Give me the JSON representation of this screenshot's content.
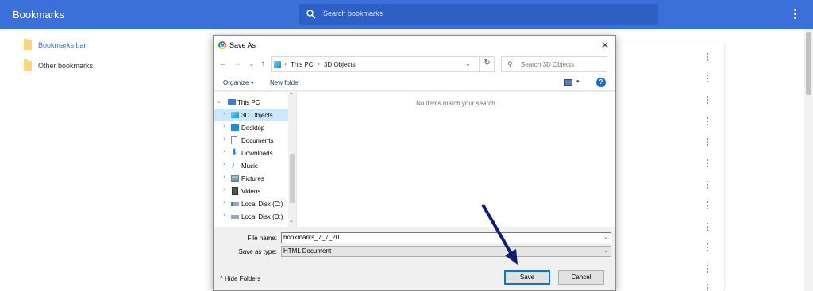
{
  "page": {
    "title": "Bookmarks",
    "search_placeholder": "Search bookmarks",
    "sidebar": [
      {
        "label": "Bookmarks bar",
        "active": true
      },
      {
        "label": "Other bookmarks",
        "active": false
      }
    ]
  },
  "dialog": {
    "title": "Save As",
    "breadcrumb": [
      "This PC",
      "3D Objects"
    ],
    "search_placeholder": "Search 3D Objects",
    "commands": {
      "organize": "Organize ▾",
      "new_folder": "New folder"
    },
    "tree": [
      {
        "label": "This PC",
        "icon": "pc-icon"
      },
      {
        "label": "3D Objects",
        "icon": "cube-icon"
      },
      {
        "label": "Desktop",
        "icon": "desktop-icon"
      },
      {
        "label": "Documents",
        "icon": "documents-icon"
      },
      {
        "label": "Downloads",
        "icon": "download-icon"
      },
      {
        "label": "Music",
        "icon": "music-icon"
      },
      {
        "label": "Pictures",
        "icon": "pictures-icon"
      },
      {
        "label": "Videos",
        "icon": "videos-icon"
      },
      {
        "label": "Local Disk (C:)",
        "icon": "disk-icon"
      },
      {
        "label": "Local Disk (D:)",
        "icon": "disk-icon"
      }
    ],
    "empty_message": "No items match your search.",
    "file_name_label": "File name:",
    "file_name_value": "bookmarks_7_7_20",
    "save_type_label": "Save as type:",
    "save_type_value": "HTML Document",
    "hide_folders": "Hide Folders",
    "save_button": "Save",
    "cancel_button": "Cancel"
  },
  "colors": {
    "header": "#3b6fd9",
    "arrow": "#0d1f6b",
    "selection": "#cce8ff"
  }
}
